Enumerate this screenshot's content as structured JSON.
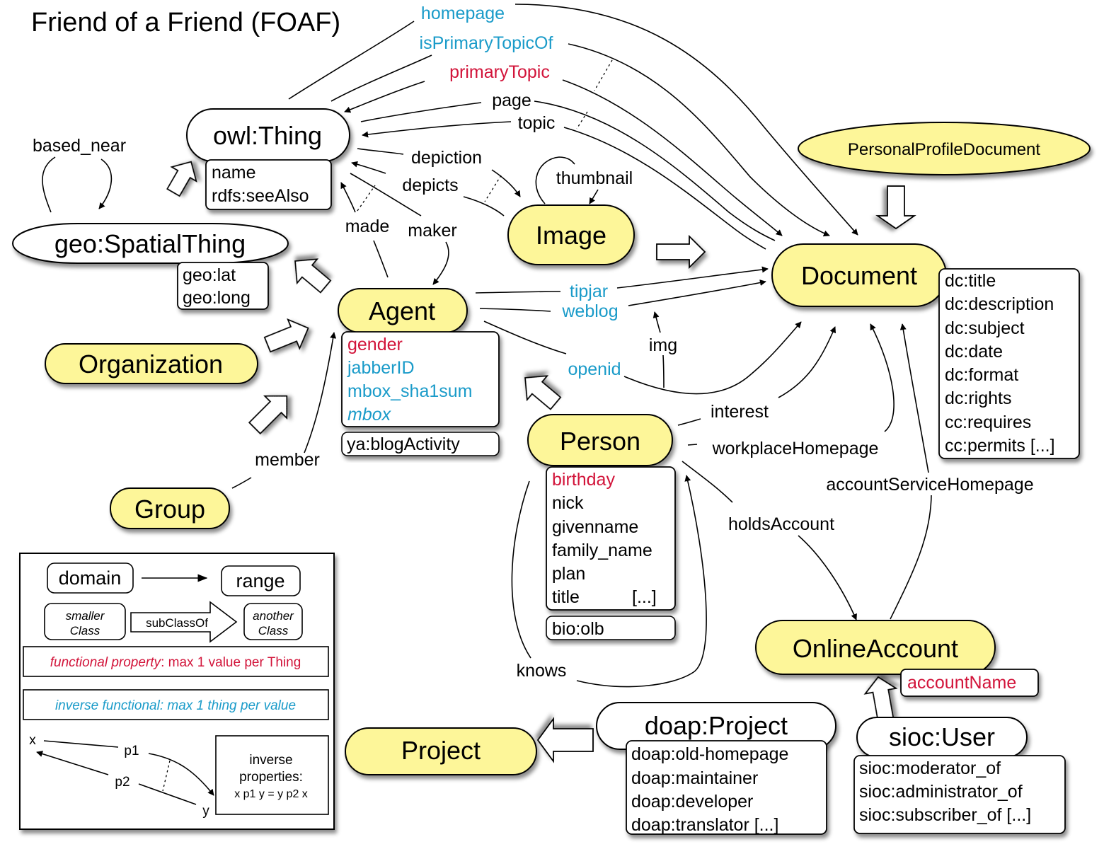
{
  "title": "Friend of a Friend (FOAF)",
  "colors": {
    "class_fill": "#fdf699",
    "external_class_fill": "#ffffff",
    "functional": "#d2143a",
    "inverse_functional": "#1a9bc9",
    "line": "#000000"
  },
  "classes": {
    "owl_thing": {
      "label": "owl:Thing",
      "props": [
        "name",
        "rdfs:seeAlso"
      ]
    },
    "geo_spatial": {
      "label": "geo:SpatialThing",
      "props": [
        "geo:lat",
        "geo:long"
      ]
    },
    "image": {
      "label": "Image"
    },
    "ppd": {
      "label": "PersonalProfileDocument"
    },
    "document": {
      "label": "Document",
      "props": [
        "dc:title",
        "dc:description",
        "dc:subject",
        "dc:date",
        "dc:format",
        "dc:rights",
        "cc:requires",
        "cc:permits [...]"
      ]
    },
    "agent": {
      "label": "Agent",
      "props": [
        "gender",
        "jabberID",
        "mbox_sha1sum",
        "mbox"
      ],
      "extra": "ya:blogActivity"
    },
    "organization": {
      "label": "Organization"
    },
    "group": {
      "label": "Group"
    },
    "person": {
      "label": "Person",
      "props": [
        "birthday",
        "nick",
        "givenname",
        "family_name",
        "plan",
        "title"
      ],
      "props_more": "[...]",
      "extra": "bio:olb"
    },
    "online_account": {
      "label": "OnlineAccount",
      "props": [
        "accountName"
      ]
    },
    "sioc_user": {
      "label": "sioc:User",
      "props": [
        "sioc:moderator_of",
        "sioc:administrator_of",
        "sioc:subscriber_of [...]"
      ]
    },
    "doap_project": {
      "label": "doap:Project",
      "props": [
        "doap:old-homepage",
        "doap:maintainer",
        "doap:developer",
        "doap:translator [...]"
      ]
    },
    "project": {
      "label": "Project"
    }
  },
  "properties": {
    "homepage": "homepage",
    "isPrimaryTopicOf": "isPrimaryTopicOf",
    "primaryTopic": "primaryTopic",
    "page": "page",
    "topic": "topic",
    "depiction": "depiction",
    "depicts": "depicts",
    "thumbnail": "thumbnail",
    "based_near": "based_near",
    "made": "made",
    "maker": "maker",
    "tipjar": "tipjar",
    "weblog": "weblog",
    "img": "img",
    "openid": "openid",
    "interest": "interest",
    "workplaceHomepage": "workplaceHomepage",
    "accountServiceHomepage": "accountServiceHomepage",
    "holdsAccount": "holdsAccount",
    "member": "member",
    "knows": "knows"
  },
  "legend": {
    "domain": "domain",
    "range": "range",
    "smaller_class": [
      "smaller",
      "Class"
    ],
    "subclassof": "subClassOf",
    "another_class": [
      "another",
      "Class"
    ],
    "functional_italic": "functional property",
    "functional_rest": ": max 1 value per Thing",
    "inverse_functional": "inverse functional: max 1 thing per value",
    "x": "x",
    "y": "y",
    "p1": "p1",
    "p2": "p2",
    "inverse_lines": [
      "inverse",
      "properties:",
      "x p1 y = y p2 x"
    ]
  }
}
